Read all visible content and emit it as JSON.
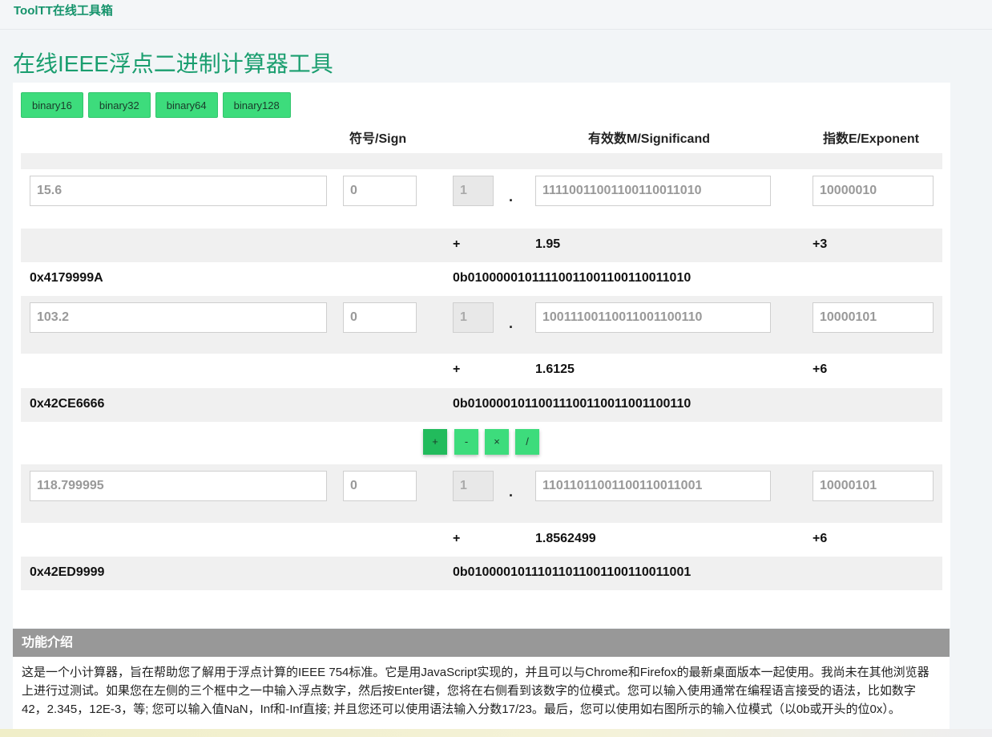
{
  "brand": "ToolTT在线工具箱",
  "page_title": "在线IEEE浮点二进制计算器工具",
  "tabs": [
    "binary16",
    "binary32",
    "binary64",
    "binary128"
  ],
  "headers": {
    "sign": "符号/Sign",
    "significand": "有效数M/Significand",
    "exponent": "指数E/Exponent"
  },
  "operand1": {
    "decimal": "15.6",
    "sign_bit": "0",
    "hidden_bit": "1",
    "mantissa_bits": "11110011001100110011010",
    "exponent_bits": "10000010",
    "sign": "+",
    "significand": "1.95",
    "exponent": "+3",
    "hex": "0x4179999A",
    "binary": "0b01000001011110011001100110011010"
  },
  "operand2": {
    "decimal": "103.2",
    "sign_bit": "0",
    "hidden_bit": "1",
    "mantissa_bits": "10011100110011001100110",
    "exponent_bits": "10000101",
    "sign": "+",
    "significand": "1.6125",
    "exponent": "+6",
    "hex": "0x42CE6666",
    "binary": "0b01000010110011100110011001100110"
  },
  "operators": [
    "+",
    "-",
    "×",
    "/"
  ],
  "active_operator": "+",
  "result": {
    "decimal": "118.799995",
    "sign_bit": "0",
    "hidden_bit": "1",
    "mantissa_bits": "11011011001100110011001",
    "exponent_bits": "10000101",
    "sign": "+",
    "significand": "1.8562499",
    "exponent": "+6",
    "hex": "0x42ED9999",
    "binary": "0b01000010111011011001100110011001"
  },
  "intro": {
    "heading": "功能介绍",
    "text": "这是一个小计算器，旨在帮助您了解用于浮点计算的IEEE 754标准。它是用JavaScript实现的，并且可以与Chrome和Firefox的最新桌面版本一起使用。我尚未在其他浏览器上进行过测试。如果您在左侧的三个框中之一中输入浮点数字，然后按Enter键，您将在右侧看到该数字的位模式。您可以输入使用通常在编程语言接受的语法，比如数字42，2.345，12E-3，等; 您可以输入值NaN，Inf和-Inf直接; 并且您还可以使用语法输入分数17/23。最后，您可以使用如右图所示的输入位模式（以0b或开头的位0x）。"
  },
  "colors": {
    "accent_green": "#3ddc7c",
    "title_green": "#1a9e6f",
    "intro_header_gray": "#989898"
  }
}
